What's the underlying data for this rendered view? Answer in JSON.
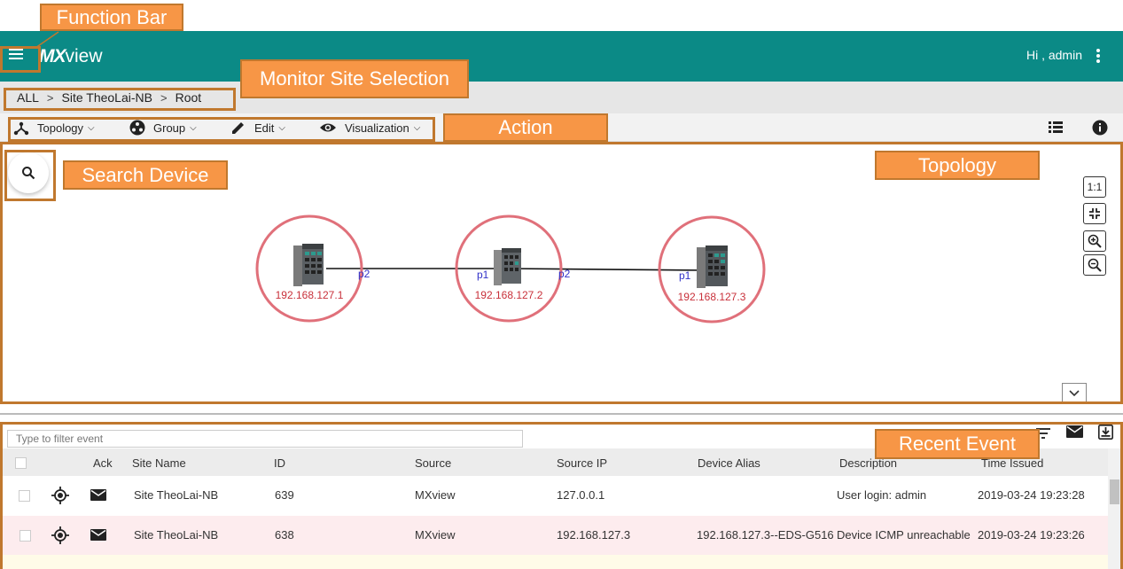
{
  "header": {
    "logo_bold": "MX",
    "logo_thin": "view",
    "greeting": "Hi , admin"
  },
  "breadcrumb": [
    "ALL",
    "Site TheoLai-NB",
    "Root"
  ],
  "toolbar": {
    "topology": "Topology",
    "group": "Group",
    "edit": "Edit",
    "visualization": "Visualization"
  },
  "topology": {
    "devices": [
      {
        "ip": "192.168.127.1"
      },
      {
        "ip": "192.168.127.2"
      },
      {
        "ip": "192.168.127.3"
      }
    ],
    "ports": [
      "p2",
      "p1",
      "p2",
      "p1"
    ],
    "zoom_ratio": "1:1",
    "device_ring_color": "#e0707a",
    "ip_color": "#c8303a",
    "port_color": "#3030c8"
  },
  "events": {
    "filter_placeholder": "Type to filter event",
    "columns": [
      "Ack",
      "Site Name",
      "ID",
      "Source",
      "Source IP",
      "Device Alias",
      "Description",
      "Time Issued"
    ],
    "rows": [
      {
        "site": "Site TheoLai-NB",
        "id": "639",
        "source": "MXview",
        "source_ip": "127.0.0.1",
        "alias": "",
        "description": "User login: admin",
        "time": "2019-03-24 19:23:28"
      },
      {
        "site": "Site TheoLai-NB",
        "id": "638",
        "source": "MXview",
        "source_ip": "192.168.127.3",
        "alias": "192.168.127.3--EDS-G516",
        "description": "Device ICMP unreachable",
        "time": "2019-03-24 19:23:26"
      }
    ]
  },
  "annotations": {
    "function_bar": "Function Bar",
    "monitor_site": "Monitor Site Selection",
    "action": "Action",
    "search_device": "Search Device",
    "topology": "Topology",
    "recent_event": "Recent Event"
  },
  "colors": {
    "appbar": "#0b8a86",
    "callout": "#f79646",
    "callout_border": "#c0782e",
    "alert_row": "#fdecee"
  }
}
